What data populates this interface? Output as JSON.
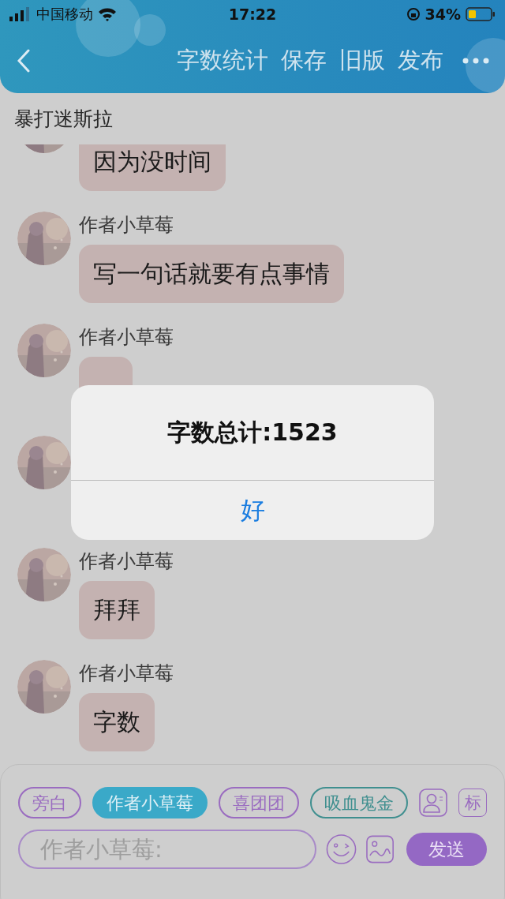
{
  "status_bar": {
    "carrier": "中国移动",
    "time": "17:22",
    "battery": "34%"
  },
  "nav": {
    "actions": [
      "字数统计",
      "保存",
      "旧版",
      "发布"
    ]
  },
  "chat_title": "暴打迷斯拉",
  "messages": [
    {
      "kind": "text",
      "text": "因为没时间"
    },
    {
      "kind": "text",
      "name": "作者小草莓",
      "text": "写一句话就要有点事情"
    },
    {
      "kind": "covered",
      "name": "作者小草莓"
    },
    {
      "kind": "avatar_only"
    },
    {
      "kind": "text",
      "name": "作者小草莓",
      "text": "拜拜"
    },
    {
      "kind": "text",
      "name": "作者小草莓",
      "text": "字数"
    }
  ],
  "roles": [
    {
      "label": "旁白",
      "selected": false,
      "color": "#9a6cc0"
    },
    {
      "label": "作者小草莓",
      "selected": true,
      "color": "#3aa9c8"
    },
    {
      "label": "喜团团",
      "selected": false,
      "color": "#9a6cc0"
    },
    {
      "label": "吸血鬼金",
      "selected": false,
      "color": "#3f8f8f"
    }
  ],
  "tag_button": "标",
  "input": {
    "placeholder": "作者小草莓:"
  },
  "send_button": "发送",
  "alert": {
    "title": "字数总计:1523",
    "button": "好"
  }
}
